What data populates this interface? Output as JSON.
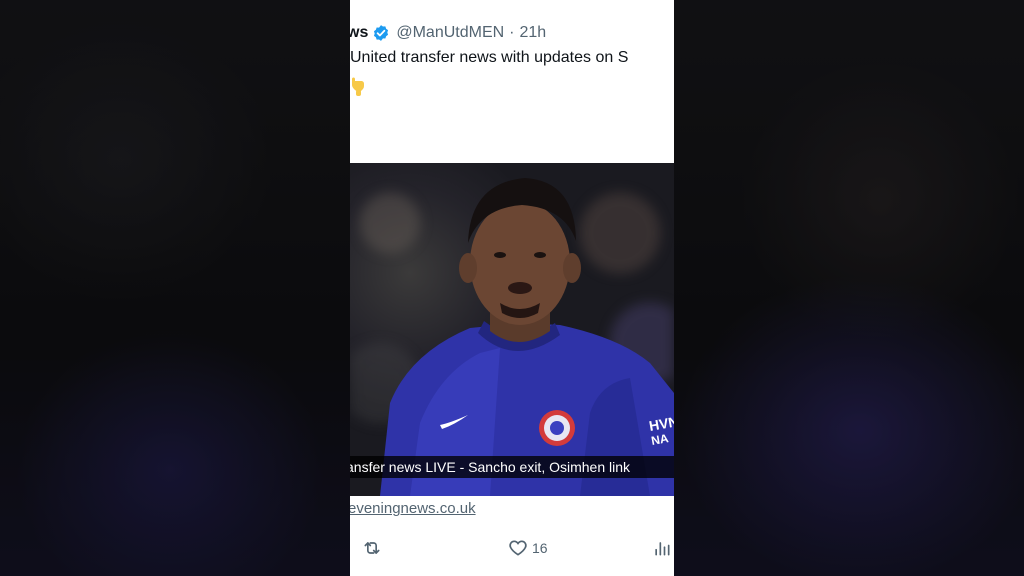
{
  "tweet": {
    "author_name": "ws",
    "handle": "@ManUtdMEN",
    "separator": "·",
    "time": "21h",
    "text": "United transfer news with updates on S",
    "emoji": "point-down-emoji"
  },
  "media": {
    "caption": "ansfer news LIVE - Sancho exit, Osimhen link",
    "sponsor_text": "HVNT NA"
  },
  "link": {
    "domain": "eveningnews.co.uk"
  },
  "actions": {
    "retweet_icon": "retweet-icon",
    "like_icon": "heart-icon",
    "like_count": "16",
    "views_icon": "bar-chart-icon"
  },
  "colors": {
    "verified_blue": "#1d9bf0",
    "secondary_text": "#536471",
    "primary_text": "#0f1419",
    "kit_blue": "#2f33a8"
  }
}
